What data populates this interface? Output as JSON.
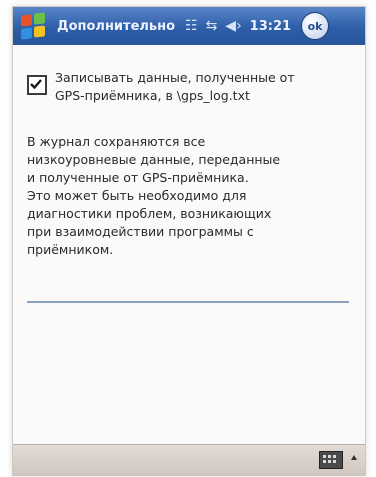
{
  "titlebar": {
    "title": "Дополнительно",
    "clock": "13:21",
    "ok_label": "ok"
  },
  "content": {
    "checkbox_label_line1": "Записывать данные, полученные от",
    "checkbox_label_line2": "GPS-приёмника, в \\gps_log.txt",
    "checkbox_checked": true,
    "description_lines": [
      "В журнал сохраняются все",
      "низкоуровневые данные, переданные",
      "и полученные от GPS-приёмника.",
      "Это может быть необходимо для",
      "диагностики проблем, возникающих",
      "при взаимодействии программы с",
      "приёмником."
    ]
  },
  "icons": {
    "start": "windows-start-icon",
    "network": "network-icon",
    "sync": "sync-arrows-icon",
    "volume": "speaker-icon",
    "keyboard": "keyboard-icon"
  },
  "colors": {
    "titlebar": "#2e5ea8",
    "divider": "#8aa0bc"
  }
}
